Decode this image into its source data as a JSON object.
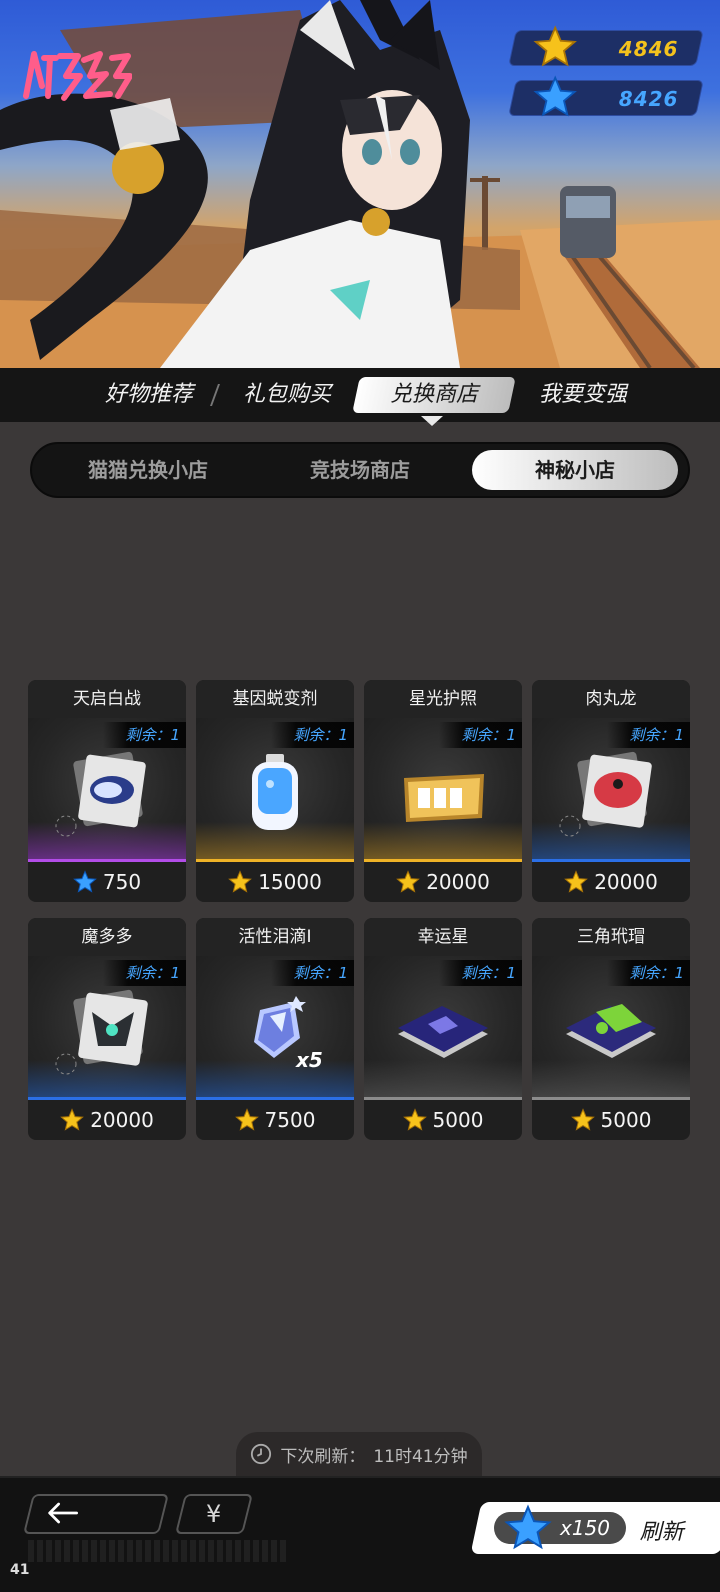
{
  "currencies": {
    "gold": {
      "icon": "gold-star-icon",
      "amount": "4846",
      "color": "#f4c21d"
    },
    "blue": {
      "icon": "blue-star-icon",
      "amount": "8426",
      "color": "#46a6ff"
    }
  },
  "top_tabs": [
    {
      "label": "好物推荐",
      "active": false
    },
    {
      "label": "礼包购买",
      "active": false
    },
    {
      "label": "兑换商店",
      "active": true
    },
    {
      "label": "我要变强",
      "active": false
    }
  ],
  "sub_tabs": [
    {
      "label": "猫猫兑换小店",
      "active": false
    },
    {
      "label": "竞技场商店",
      "active": false
    },
    {
      "label": "神秘小店",
      "active": true
    }
  ],
  "items": [
    {
      "name": "天启白战",
      "remain": "剩余：1",
      "price": "750",
      "currency": "blue-star-icon",
      "rarity": "purple"
    },
    {
      "name": "基因蜕变剂",
      "remain": "剩余：1",
      "price": "15000",
      "currency": "gold-star-icon",
      "rarity": "gold"
    },
    {
      "name": "星光护照",
      "remain": "剩余：1",
      "price": "20000",
      "currency": "gold-star-icon",
      "rarity": "gold"
    },
    {
      "name": "肉丸龙",
      "remain": "剩余：1",
      "price": "20000",
      "currency": "gold-star-icon",
      "rarity": "blue"
    },
    {
      "name": "魔多多",
      "remain": "剩余：1",
      "price": "20000",
      "currency": "gold-star-icon",
      "rarity": "blue"
    },
    {
      "name": "活性泪滴I",
      "remain": "剩余：1",
      "price": "7500",
      "currency": "gold-star-icon",
      "rarity": "blue",
      "qty": "x5"
    },
    {
      "name": "幸运星",
      "remain": "剩余：1",
      "price": "5000",
      "currency": "gold-star-icon",
      "rarity": "grey"
    },
    {
      "name": "三角玳瑁",
      "remain": "剩余：1",
      "price": "5000",
      "currency": "gold-star-icon",
      "rarity": "grey"
    }
  ],
  "refresh_timer": {
    "label": "下次刷新：",
    "value": "11时41分钟"
  },
  "bottom": {
    "back_icon": "back-arrow-icon",
    "yen_label": "¥",
    "refresh_cost": "x150",
    "refresh_label": "刷新"
  },
  "fps": "41"
}
